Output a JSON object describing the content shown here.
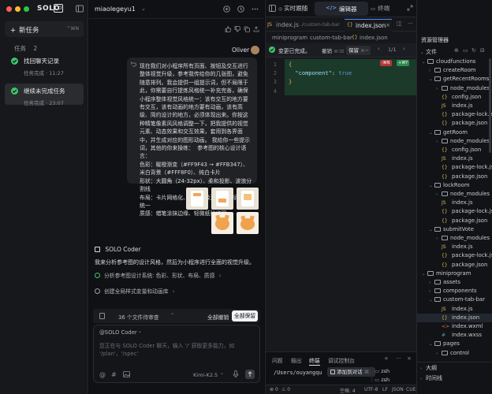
{
  "app": {
    "logo_text": "SOLO",
    "logo_badge": "CO",
    "window_dots": [
      "#ff5f57",
      "#febc2e",
      "#28c840"
    ]
  },
  "sidebar": {
    "new_task_label": "新任务",
    "new_task_shortcut": "^⌘N",
    "tasks_label": "任务",
    "tasks_count": "2",
    "tasks": [
      {
        "title": "找回聊天记录",
        "status": "任务完成 · 11:27"
      },
      {
        "title": "继续未完成任务",
        "status": "任务完成 · 23:07"
      }
    ]
  },
  "chat": {
    "workspace": "miaolegeyu1",
    "user_name": "Oliver",
    "user_message": "现在我们对小程序所有页面、按钮及交互进行整体视觉升级，参考我传给你的几张图，避免随意排列。我会提供一组提示词，但不局限于此，你需要自行提炼风格统一补充完善，确保小程序整体视觉风格统一：该有交互的地方要有交互，该有动画的地方要有动画，该有高级、简约设计的地方，必须体现出来。你按这种精笔像素风风格调整一下，把我提供的视觉元素、动态效果和交互效果，套用到各界面中，并生成对应的图形动画。 我给你一些提示词，其他的你来操练：  参考图的核心设计语言：\n色彩：暖橙渐变（#FF9F43 → #FFB347）、米白背景（#FFF8F0）、纯白卡片\n形状：大圆角（24-32px）、柔和投影、波浪分割线\n布局：卡片网格化、信息层级清晰、图标系统统一\n质感：蜡笔涂抹边缘、轻微纸张纹理",
    "agent_name": "SOLO Coder",
    "agent_message": "我来分析参考图的设计风格，然后为小程序进行全面的视觉升级。",
    "steps": [
      {
        "text": "分析参考图设计系统: 色彩、形状、布局、质感"
      },
      {
        "text": "创建全局样式变量和动画库"
      }
    ],
    "pending_text": "36 个文件待审查",
    "reject_all": "全部撤销",
    "keep_all": "全部保留",
    "input_mention": "@SOLO Coder",
    "input_placeholder": "您正在与 SOLO Coder 聊天，输入 '/' 获取更多能力，如 '/plan'，'/spec'",
    "model": "Kimi-K2.5"
  },
  "editor": {
    "tabs": {
      "realtime": "实时跟随",
      "editor": "编辑器",
      "terminal": "终端"
    },
    "file_tabs": [
      {
        "name": "index.js",
        "hint": ".../custom-tab-bar"
      },
      {
        "name": "index.json"
      }
    ],
    "breadcrumb": [
      "miniprogram",
      "custom-tab-bar",
      "index.json"
    ],
    "diff": {
      "label": "变更已完成。",
      "undo": "撤销",
      "undo_key": "⌘⌫",
      "keep": "保留",
      "keep_key": "⌘⏎",
      "counter": "1/1"
    },
    "code": [
      {
        "n": "1",
        "text": "{"
      },
      {
        "n": "2",
        "text": "  \"component\": true"
      },
      {
        "n": "3",
        "text": "}"
      },
      {
        "n": "4",
        "text": ""
      }
    ],
    "badge_minus": "-⌘N",
    "badge_plus": "+⌘Y",
    "bottom_tabs": [
      "问题",
      "输出",
      "终端",
      "调试控制台"
    ],
    "terminal_path": "/Users/ouyangqu",
    "terminal_tooltip": "添加到对话",
    "terminal_tooltip_key": "⌘ I",
    "terminal_sessions": [
      "zsh",
      "zsh"
    ],
    "status": {
      "errors": "0",
      "warnings": "0",
      "spaces": "空格: 4",
      "encoding": "UTF-8",
      "eol": "LF",
      "lang": "JSON",
      "extra": "CUE"
    }
  },
  "explorer": {
    "title": "资源管理器",
    "files_label": "文件",
    "tree": [
      {
        "label": "cloudfunctions",
        "type": "folder",
        "open": true,
        "depth": 1
      },
      {
        "label": "createRoom",
        "type": "folder",
        "open": false,
        "depth": 2
      },
      {
        "label": "getRecentRooms",
        "type": "folder",
        "open": true,
        "depth": 2
      },
      {
        "label": "node_modules",
        "type": "folder",
        "open": false,
        "depth": 3
      },
      {
        "label": "config.json",
        "type": "json",
        "depth": 3
      },
      {
        "label": "index.js",
        "type": "js",
        "depth": 3
      },
      {
        "label": "package-lock.json",
        "type": "json",
        "depth": 3
      },
      {
        "label": "package.json",
        "type": "json",
        "depth": 3
      },
      {
        "label": "getRoom",
        "type": "folder",
        "open": true,
        "depth": 2
      },
      {
        "label": "node_modules",
        "type": "folder",
        "open": false,
        "depth": 3
      },
      {
        "label": "config.json",
        "type": "json",
        "depth": 3
      },
      {
        "label": "index.js",
        "type": "js",
        "depth": 3
      },
      {
        "label": "package-lock.json",
        "type": "json",
        "depth": 3
      },
      {
        "label": "package.json",
        "type": "json",
        "depth": 3
      },
      {
        "label": "lockRoom",
        "type": "folder",
        "open": true,
        "depth": 2
      },
      {
        "label": "node_modules",
        "type": "folder",
        "open": false,
        "depth": 3
      },
      {
        "label": "index.js",
        "type": "js",
        "depth": 3
      },
      {
        "label": "package-lock.json",
        "type": "json",
        "depth": 3
      },
      {
        "label": "package.json",
        "type": "json",
        "depth": 3
      },
      {
        "label": "submitVote",
        "type": "folder",
        "open": true,
        "depth": 2
      },
      {
        "label": "node_modules",
        "type": "folder",
        "open": false,
        "depth": 3
      },
      {
        "label": "index.js",
        "type": "js",
        "depth": 3
      },
      {
        "label": "package-lock.json",
        "type": "json",
        "depth": 3
      },
      {
        "label": "package.json",
        "type": "json",
        "depth": 3
      },
      {
        "label": "miniprogram",
        "type": "folder",
        "open": true,
        "depth": 1
      },
      {
        "label": "assets",
        "type": "folder",
        "open": false,
        "depth": 2
      },
      {
        "label": "components",
        "type": "folder",
        "open": false,
        "depth": 2
      },
      {
        "label": "custom-tab-bar",
        "type": "folder",
        "open": true,
        "depth": 2
      },
      {
        "label": "index.js",
        "type": "js",
        "depth": 3
      },
      {
        "label": "index.json",
        "type": "json",
        "depth": 3,
        "selected": true
      },
      {
        "label": "index.wxml",
        "type": "wxml",
        "depth": 3
      },
      {
        "label": "index.wxss",
        "type": "wxss",
        "depth": 3
      },
      {
        "label": "pages",
        "type": "folder",
        "open": true,
        "depth": 2
      },
      {
        "label": "control",
        "type": "folder",
        "open": false,
        "depth": 3
      }
    ],
    "outline_label": "大纲",
    "timeline_label": "时间线"
  }
}
